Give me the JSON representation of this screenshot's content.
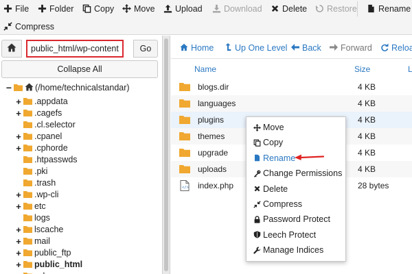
{
  "toolbar": {
    "file": "File",
    "folder": "Folder",
    "copy": "Copy",
    "move": "Move",
    "upload": "Upload",
    "download": "Download",
    "delete": "Delete",
    "restore": "Restore",
    "rename": "Rename",
    "compress": "Compress"
  },
  "path": {
    "value": "public_html/wp-content",
    "go_label": "Go",
    "collapse_label": "Collapse All"
  },
  "tree": {
    "root": "(/home/technicalstandar)",
    "items": [
      {
        "label": ".appdata",
        "expandable": true
      },
      {
        "label": ".cagefs",
        "expandable": true
      },
      {
        "label": ".cl.selector",
        "expandable": false
      },
      {
        "label": ".cpanel",
        "expandable": true
      },
      {
        "label": ".cphorde",
        "expandable": true
      },
      {
        "label": ".htpasswds",
        "expandable": false
      },
      {
        "label": ".pki",
        "expandable": false
      },
      {
        "label": ".trash",
        "expandable": false
      },
      {
        "label": ".wp-cli",
        "expandable": true
      },
      {
        "label": "etc",
        "expandable": true
      },
      {
        "label": "logs",
        "expandable": false
      },
      {
        "label": "lscache",
        "expandable": true
      },
      {
        "label": "mail",
        "expandable": true
      },
      {
        "label": "public_ftp",
        "expandable": true
      },
      {
        "label": "public_html",
        "expandable": true,
        "bold": true
      },
      {
        "label": "ssl",
        "expandable": true
      }
    ]
  },
  "nav": {
    "home": "Home",
    "up": "Up One Level",
    "back": "Back",
    "forward": "Forward",
    "reload": "Reload"
  },
  "columns": {
    "name": "Name",
    "size": "Size",
    "last": "L"
  },
  "files": [
    {
      "name": "blogs.dir",
      "size": "4 KB",
      "type": "folder"
    },
    {
      "name": "languages",
      "size": "4 KB",
      "type": "folder"
    },
    {
      "name": "plugins",
      "size": "4 KB",
      "type": "folder",
      "selected": true
    },
    {
      "name": "themes",
      "size": "4 KB",
      "type": "folder"
    },
    {
      "name": "upgrade",
      "size": "4 KB",
      "type": "folder"
    },
    {
      "name": "uploads",
      "size": "4 KB",
      "type": "folder"
    },
    {
      "name": "index.php",
      "size": "28 bytes",
      "type": "php"
    }
  ],
  "context_menu": {
    "items": [
      {
        "label": "Move",
        "icon": "move-icon"
      },
      {
        "label": "Copy",
        "icon": "copy-icon"
      },
      {
        "label": "Rename",
        "icon": "file-icon",
        "highlight": true
      },
      {
        "label": "Change Permissions",
        "icon": "key-icon"
      },
      {
        "label": "Delete",
        "icon": "close-icon"
      },
      {
        "label": "Compress",
        "icon": "compress-icon"
      },
      {
        "label": "Password Protect",
        "icon": "lock-icon"
      },
      {
        "label": "Leech Protect",
        "icon": "shield-icon"
      },
      {
        "label": "Manage Indices",
        "icon": "wrench-icon"
      }
    ]
  },
  "colors": {
    "accent": "#2a78c2",
    "folder": "#f0a830",
    "highlight_border": "#d9282f",
    "arrow": "#e02424"
  }
}
